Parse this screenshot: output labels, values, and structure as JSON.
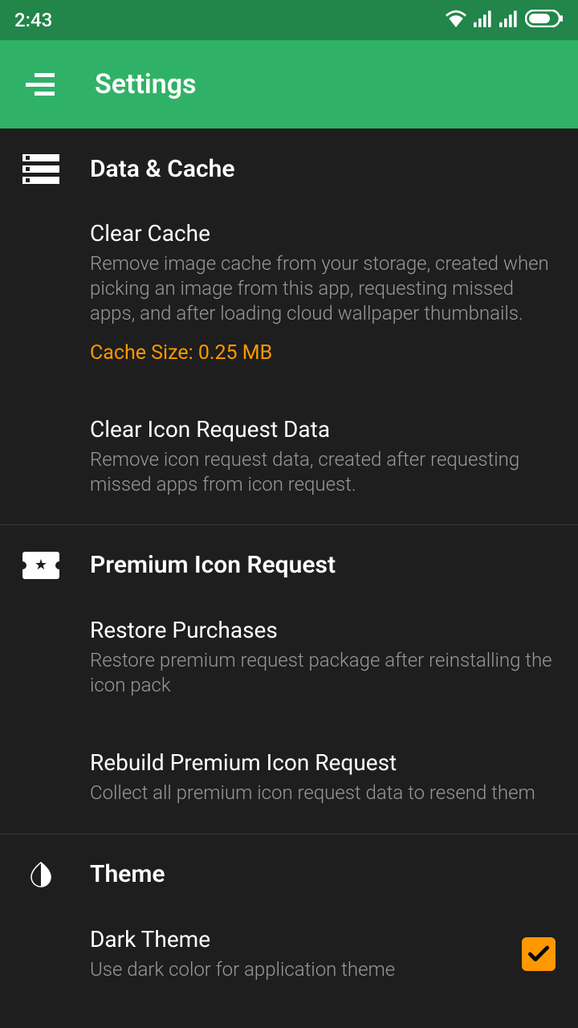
{
  "statusBar": {
    "time": "2:43"
  },
  "appBar": {
    "title": "Settings"
  },
  "sections": {
    "dataCache": {
      "title": "Data & Cache",
      "clearCache": {
        "title": "Clear Cache",
        "desc": "Remove image cache from your storage, created when picking an image from this app, requesting missed apps, and after loading cloud wallpaper thumbnails.",
        "cacheSize": "Cache Size: 0.25 MB"
      },
      "clearIconRequest": {
        "title": "Clear Icon Request Data",
        "desc": "Remove icon request data, created after requesting missed apps from icon request."
      }
    },
    "premium": {
      "title": "Premium Icon Request",
      "restore": {
        "title": "Restore Purchases",
        "desc": "Restore premium request package after reinstalling the icon pack"
      },
      "rebuild": {
        "title": "Rebuild Premium Icon Request",
        "desc": "Collect all premium icon request data to resend them"
      }
    },
    "theme": {
      "title": "Theme",
      "darkTheme": {
        "title": "Dark Theme",
        "desc": "Use dark color for application theme"
      }
    }
  }
}
